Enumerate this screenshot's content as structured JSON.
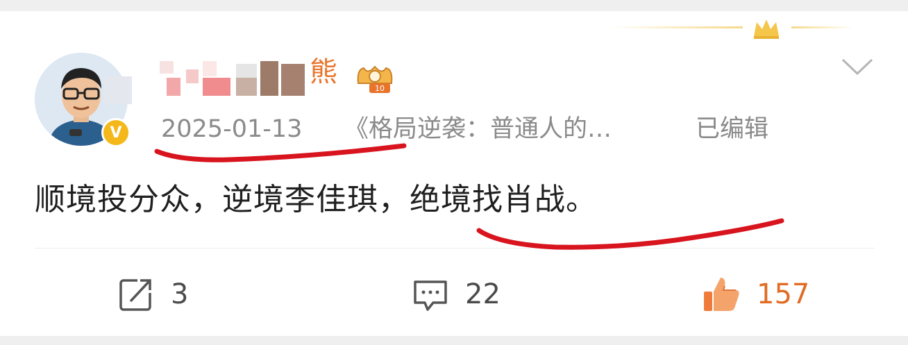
{
  "post": {
    "author": {
      "nickname_suffix": "熊",
      "verified_mark": "V",
      "level": "10"
    },
    "date": "2025-01-13",
    "source": "《格局逆袭：普通人的…",
    "edited": "已编辑",
    "text": "顺境投分众，逆境李佳琪，绝境找肖战。"
  },
  "actions": {
    "repost_count": "3",
    "comment_count": "22",
    "like_count": "157"
  },
  "colors": {
    "accent_orange": "#e8742b",
    "annotation_red": "#d8141e",
    "meta_gray": "#8a8a8a",
    "verified_gold": "#f5b81a"
  }
}
